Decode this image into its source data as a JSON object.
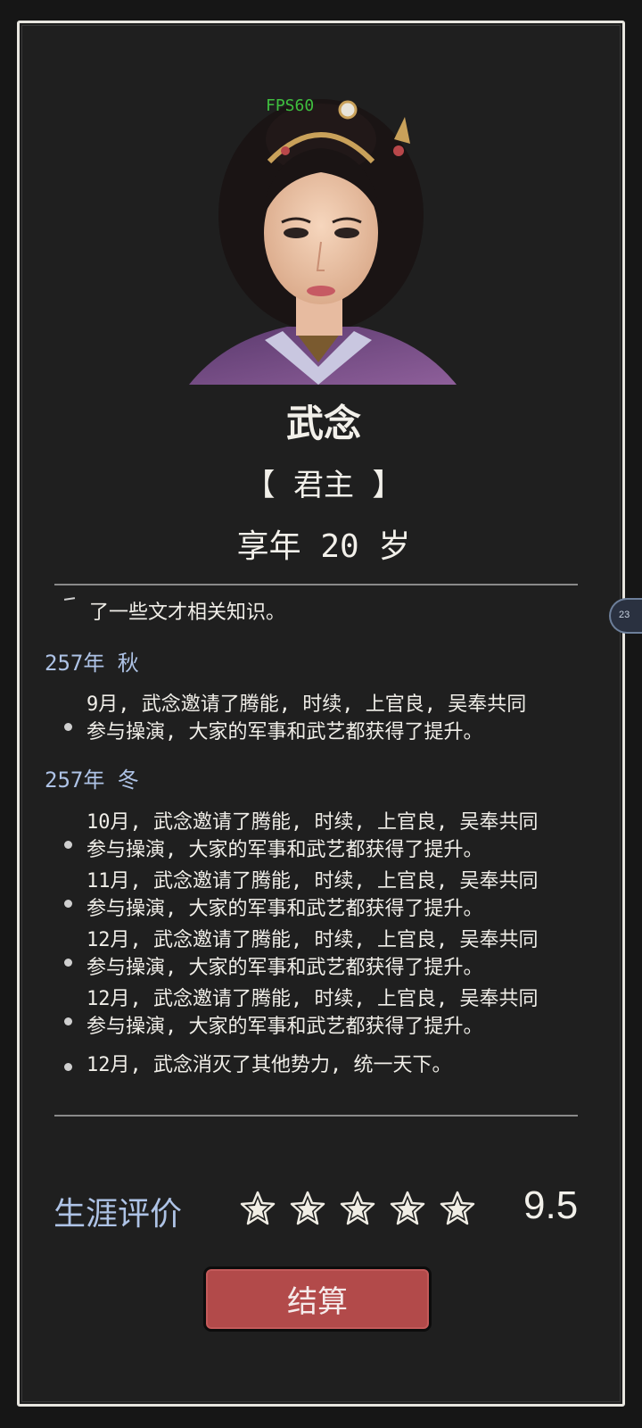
{
  "overlay": {
    "fps": "FPS60"
  },
  "character": {
    "name": "武念",
    "title": "【 君主 】",
    "age": "享年 20 岁"
  },
  "log": {
    "fragment": "了一些文才相关知识。",
    "sections": [
      {
        "season": "257年 秋",
        "entries": [
          {
            "lines": [
              "9月, 武念邀请了腾能, 时续, 上官良, 吴奉共同",
              "参与操演, 大家的军事和武艺都获得了提升。"
            ]
          }
        ]
      },
      {
        "season": "257年 冬",
        "entries": [
          {
            "lines": [
              "10月, 武念邀请了腾能, 时续, 上官良, 吴奉共同",
              "参与操演, 大家的军事和武艺都获得了提升。"
            ]
          },
          {
            "lines": [
              "11月, 武念邀请了腾能, 时续, 上官良, 吴奉共同",
              "参与操演, 大家的军事和武艺都获得了提升。"
            ]
          },
          {
            "lines": [
              "12月, 武念邀请了腾能, 时续, 上官良, 吴奉共同",
              "参与操演, 大家的军事和武艺都获得了提升。"
            ]
          },
          {
            "lines": [
              "12月, 武念邀请了腾能, 时续, 上官良, 吴奉共同",
              "参与操演, 大家的军事和武艺都获得了提升。"
            ]
          },
          {
            "lines": [
              "12月, 武念消灭了其他势力, 统一天下。"
            ]
          }
        ]
      }
    ]
  },
  "rating": {
    "label": "生涯评价",
    "stars_filled": 5,
    "stars_total": 5,
    "score": "9.5"
  },
  "actions": {
    "settle_label": "结算"
  },
  "side_handle": {
    "label": "23"
  },
  "colors": {
    "panel_bg": "#1f1f1f",
    "accent_blue": "#aec3e6",
    "button_red": "#b24a4a",
    "fps_green": "#3fbf3f"
  }
}
